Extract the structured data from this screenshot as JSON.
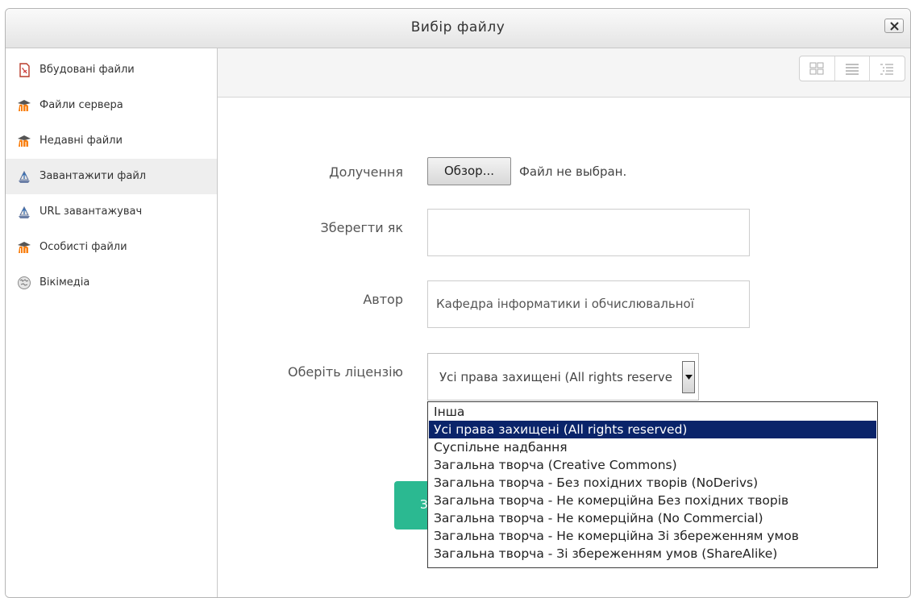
{
  "dialog": {
    "title": "Вибір файлу"
  },
  "sidebar": {
    "items": [
      {
        "label": "Вбудовані файли",
        "icon": "pdf-icon"
      },
      {
        "label": "Файли сервера",
        "icon": "moodle-icon"
      },
      {
        "label": "Недавні файли",
        "icon": "moodle-icon"
      },
      {
        "label": "Завантажити файл",
        "icon": "upload-icon",
        "active": true
      },
      {
        "label": "URL завантажувач",
        "icon": "upload-icon"
      },
      {
        "label": "Особисті файли",
        "icon": "moodle-icon"
      },
      {
        "label": "Вікімедіа",
        "icon": "wikimedia-icon"
      }
    ]
  },
  "toolbar": {
    "views": [
      "grid-view-icon",
      "list-view-icon",
      "tree-view-icon"
    ]
  },
  "form": {
    "attachment_label": "Долучення",
    "browse_button": "Обзор...",
    "file_status": "Файл не выбран.",
    "save_as_label": "Зберегти як",
    "save_as_value": "",
    "author_label": "Автор",
    "author_value": "Кафедра інформатики і обчислювальної",
    "license_label": "Оберіть ліцензію",
    "license_selected": "Усі права захищені (All rights reserved)",
    "upload_button_visible": "За"
  },
  "license_options": [
    "Інша",
    "Усі права захищені (All rights reserved)",
    "Суспільне надбання",
    "Загальна творча (Creative Commons)",
    "Загальна творча - Без похідних творів (NoDerivs)",
    "Загальна творча - Не комерційна Без похідних творів",
    "Загальна творча - Не комерційна (No Commercial)",
    "Загальна творча - Не комерційна Зі збереженням умов",
    "Загальна творча - Зі збереженням умов (ShareAlike)"
  ],
  "colors": {
    "accent_green": "#2bb991",
    "selected_option": "#0a246a",
    "moodle_orange": "#f98012"
  }
}
